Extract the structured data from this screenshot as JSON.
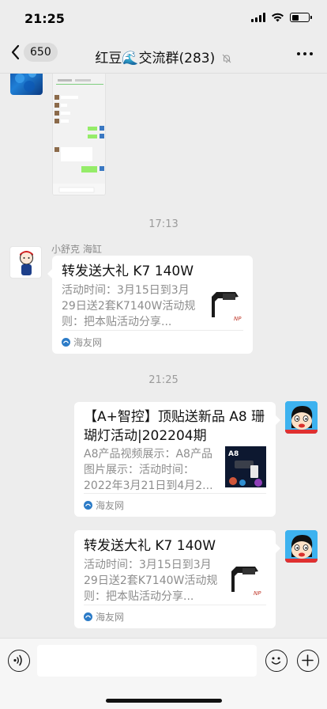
{
  "status_bar": {
    "time": "21:25",
    "battery_level": 0.42
  },
  "navbar": {
    "back_count": "650",
    "title": "红豆🌊交流群(283)"
  },
  "messages": [
    {
      "type": "time",
      "text": "17:13"
    },
    {
      "type": "card",
      "side": "left",
      "sender": "小舒克 海缸",
      "title": "转发送大礼  K7 140W",
      "desc": "活动时间：3月15日到3月29日送2套K7140W活动规则：把本贴活动分享...",
      "source": "海友网"
    },
    {
      "type": "time",
      "text": "21:25"
    },
    {
      "type": "card",
      "side": "right",
      "title": "【A+智控】顶贴送新品 A8 珊瑚灯活动|202204期",
      "desc": "A8产品视频展示：A8产品图片展示：活动时间：2022年3月21日到4月2...",
      "source": "海友网"
    },
    {
      "type": "card",
      "side": "right",
      "title": "转发送大礼  K7 140W",
      "desc": "活动时间：3月15日到3月29日送2套K7140W活动规则：把本贴活动分享...",
      "source": "海友网"
    }
  ],
  "input_bar": {
    "value": ""
  },
  "icons": {
    "back": "chevron-left-icon",
    "mute": "bell-slash-icon",
    "more": "more-dots-icon",
    "voice": "voice-icon",
    "emoji": "smiley-icon",
    "plus": "plus-icon",
    "source": "haiyou-logo-icon"
  },
  "colors": {
    "chat_background": "#ededed",
    "card_background": "#ffffff",
    "meta_text": "#8d8d8d",
    "input_bar": "#f6f6f6"
  }
}
